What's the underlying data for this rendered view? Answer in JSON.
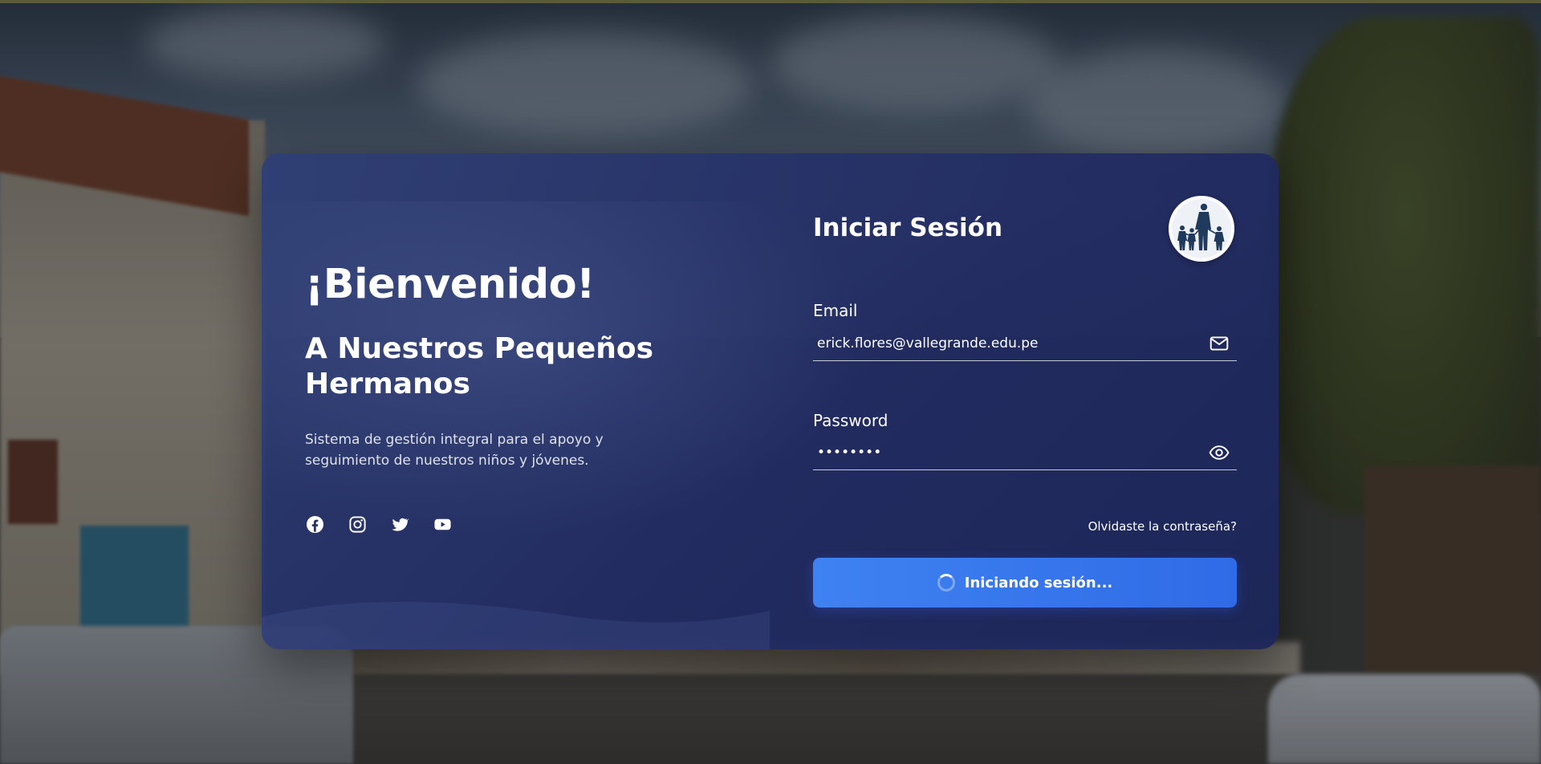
{
  "welcome": {
    "title": "¡Bienvenido!",
    "subtitle": "A Nuestros Pequeños Hermanos",
    "description": "Sistema de gestión integral para el apoyo y seguimiento de nuestros niños y jóvenes."
  },
  "socials": [
    {
      "name": "facebook",
      "icon": "facebook-icon"
    },
    {
      "name": "instagram",
      "icon": "instagram-icon"
    },
    {
      "name": "twitter",
      "icon": "twitter-icon"
    },
    {
      "name": "youtube",
      "icon": "youtube-icon"
    }
  ],
  "login": {
    "title": "Iniciar Sesión",
    "email_label": "Email",
    "email_value": "erick.flores@vallegrande.edu.pe",
    "email_icon": "mail-icon",
    "password_label": "Password",
    "password_value": "••••••••",
    "password_icon": "eye-icon",
    "forgot_label": "Olvidaste la contraseña?",
    "submit_label": "Iniciando sesión...",
    "submit_state": "loading"
  },
  "logo": {
    "icon": "family-silhouette-logo"
  },
  "colors": {
    "card_bg": "#23306a",
    "button": "#3b7cf0",
    "text": "#ffffff"
  }
}
